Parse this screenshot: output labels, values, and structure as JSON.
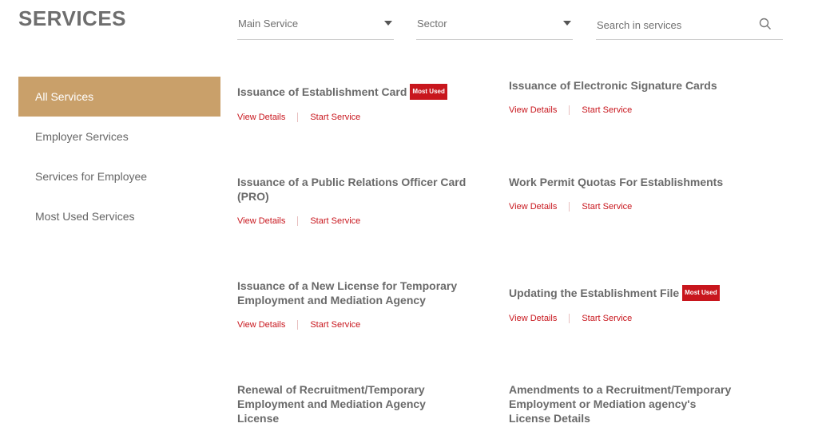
{
  "header": {
    "title": "SERVICES"
  },
  "filters": {
    "main_service": "Main Service",
    "sector": "Sector",
    "search_placeholder": "Search in services"
  },
  "sidebar": {
    "items": [
      {
        "label": "All Services",
        "active": true
      },
      {
        "label": "Employer Services",
        "active": false
      },
      {
        "label": "Services for Employee",
        "active": false
      },
      {
        "label": "Most Used Services",
        "active": false
      }
    ]
  },
  "services": [
    {
      "title": "Issuance of Establishment Card",
      "badge": "Most Used",
      "view": "View Details",
      "start": "Start Service"
    },
    {
      "title": "Issuance of Electronic Signature Cards",
      "badge": "",
      "view": "View Details",
      "start": "Start Service"
    },
    {
      "title": "Issuance of a Public Relations Officer Card (PRO)",
      "badge": "",
      "view": "View Details",
      "start": "Start Service"
    },
    {
      "title": "Work Permit Quotas For Establishments",
      "badge": "",
      "view": "View Details",
      "start": "Start Service"
    },
    {
      "title": "Issuance of a New License for Temporary Employment and Mediation Agency",
      "badge": "",
      "view": "View Details",
      "start": "Start Service"
    },
    {
      "title": "Updating the Establishment File",
      "badge": "Most Used",
      "view": "View Details",
      "start": "Start Service"
    },
    {
      "title": "Renewal of Recruitment/Temporary Employment and Mediation Agency License",
      "badge": ""
    },
    {
      "title": "Amendments to a Recruitment/Temporary Employment or Mediation agency's License Details",
      "badge": ""
    }
  ],
  "colors": {
    "accent": "#c9a06a",
    "link": "#c8161d",
    "badge": "#c8161d"
  }
}
